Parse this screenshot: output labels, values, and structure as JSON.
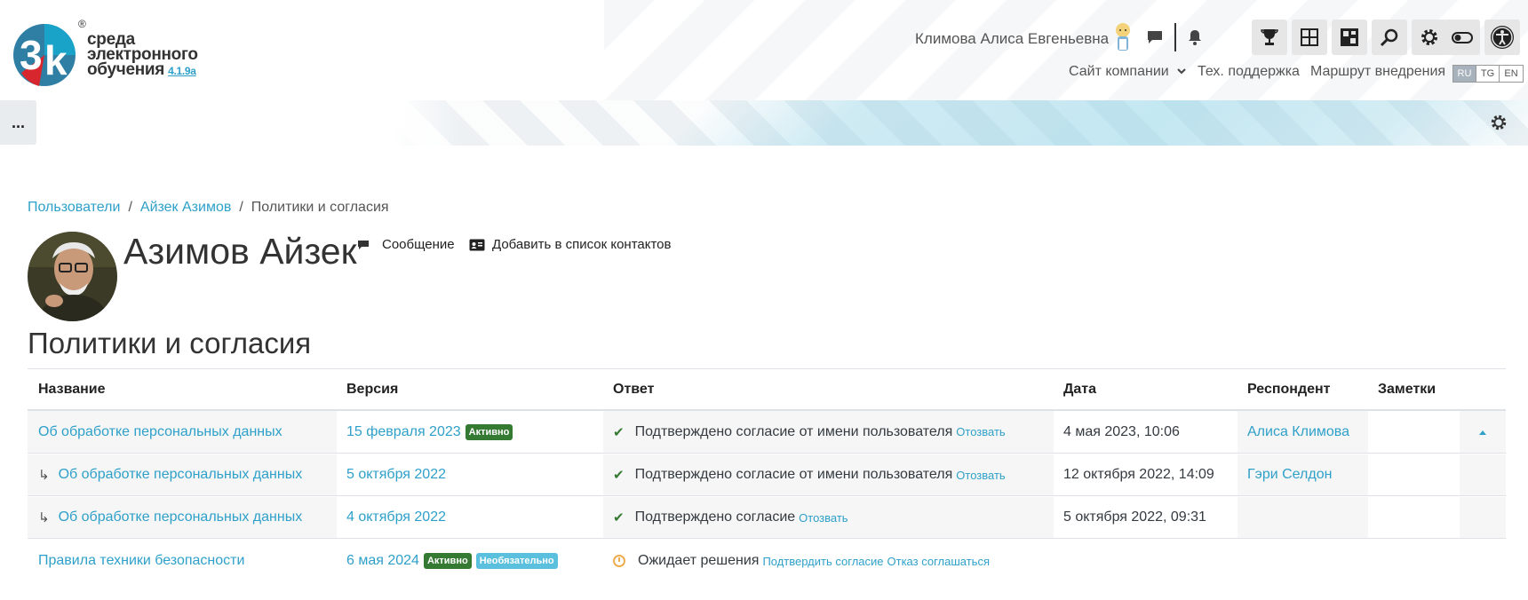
{
  "header": {
    "logo_text_line1": "среда",
    "logo_text_line2": "электронного",
    "logo_text_line3": "обучения",
    "logo_version": "4.1.9a",
    "logo_reg": "®",
    "user_name": "Климова Алиса Евгеньевна",
    "nav": {
      "company_site": "Сайт компании",
      "support": "Тех. поддержка",
      "route": "Маршрут внедрения"
    },
    "languages": [
      "RU",
      "TG",
      "EN"
    ],
    "active_language": "RU",
    "tool_icons": [
      "trophy-icon",
      "dashboard-icon",
      "puzzle-icon",
      "search-icon",
      "gear-icon",
      "toggle-icon",
      "accessibility-icon"
    ],
    "menu_label": "..."
  },
  "breadcrumb": {
    "items": [
      "Пользователи",
      "Айзек Азимов",
      "Политики и согласия"
    ],
    "separator": "/"
  },
  "profile": {
    "name": "Азимов Айзек",
    "message_label": "Сообщение",
    "add_contact_label": "Добавить в список контактов"
  },
  "section_title": "Политики и согласия",
  "table": {
    "headers": {
      "name": "Название",
      "version": "Версия",
      "answer": "Ответ",
      "date": "Дата",
      "respondent": "Респондент",
      "notes": "Заметки"
    },
    "rows": [
      {
        "name": "Об обработке персональных данных",
        "version": "15 февраля 2023",
        "badges": [
          "Активно"
        ],
        "answer": "Подтверждено согласие от имени пользователя",
        "answer_links": [
          "Отозвать"
        ],
        "date": "4 мая 2023, 10:06",
        "respondent": "Алиса Климова",
        "notes": "",
        "child": false
      },
      {
        "name": "Об обработке персональных данных",
        "version": "5 октября 2022",
        "badges": [],
        "answer": "Подтверждено согласие от имени пользователя",
        "answer_links": [
          "Отозвать"
        ],
        "date": "12 октября 2022, 14:09",
        "respondent": "Гэри Селдон",
        "notes": "",
        "child": true
      },
      {
        "name": "Об обработке персональных данных",
        "version": "4 октября 2022",
        "badges": [],
        "answer": "Подтверждено согласие",
        "answer_links": [
          "Отозвать"
        ],
        "date": "5 октября 2022, 09:31",
        "respondent": "",
        "notes": "",
        "child": true
      },
      {
        "name": "Правила техники безопасности",
        "version": "6 мая 2024",
        "badges": [
          "Активно",
          "Необязательно"
        ],
        "answer": "Ожидает решения",
        "answer_links": [
          "Подтвердить согласие",
          "Отказ соглашаться"
        ],
        "date": "",
        "respondent": "",
        "notes": "",
        "child": false
      }
    ]
  },
  "colors": {
    "link": "#2ea0c9",
    "badge_active": "#357a32",
    "badge_optional": "#5bc0de",
    "check": "#357a32",
    "pending": "#f0ad4e"
  }
}
